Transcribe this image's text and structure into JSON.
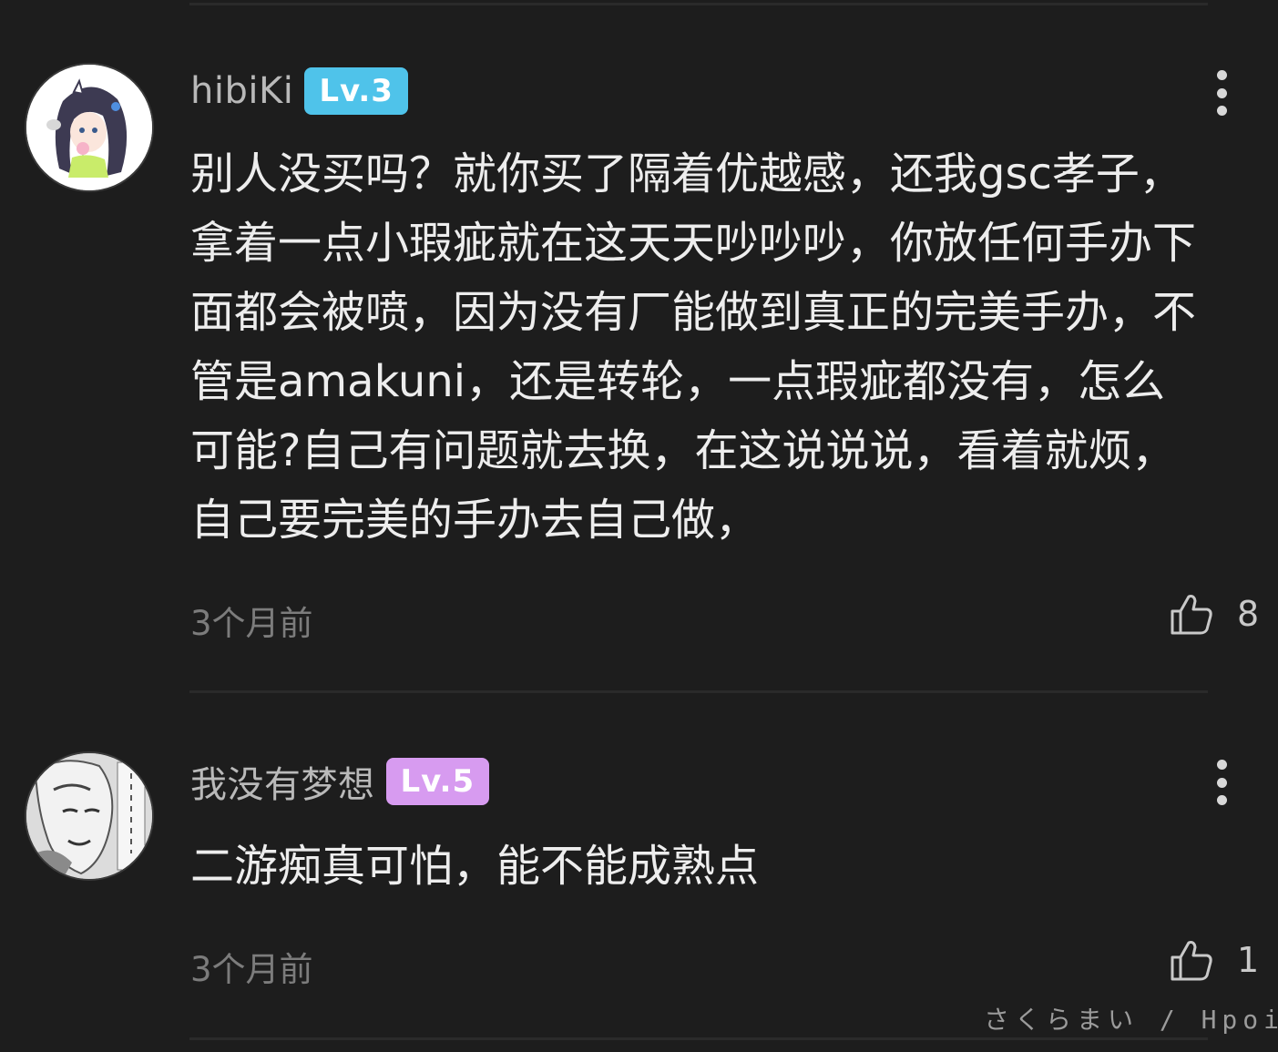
{
  "comments": [
    {
      "username": "hibiKi",
      "level": "Lv.3",
      "level_color": "#4fc3ea",
      "avatar": "avatar-anime-girl",
      "content": "别人没买吗？就你买了隔着优越感，还我gsc孝子，拿着一点小瑕疵就在这天天吵吵吵，你放任何手办下面都会被喷，因为没有厂能做到真正的完美手办，不管是amakuni，还是转轮，一点瑕疵都没有，怎么可能?自己有问题就去换，在这说说说，看着就烦，自己要完美的手办去自己做，",
      "time": "3个月前",
      "likes": "8"
    },
    {
      "username": "我没有梦想",
      "level": "Lv.5",
      "level_color": "#d79bf0",
      "avatar": "avatar-manga-character",
      "content": "二游痴真可怕，能不能成熟点",
      "time": "3个月前",
      "likes": "1"
    }
  ],
  "icons": {
    "more": "more-vertical-icon",
    "like": "thumbs-up-icon"
  },
  "watermark": "さくらまい / Hpoi"
}
